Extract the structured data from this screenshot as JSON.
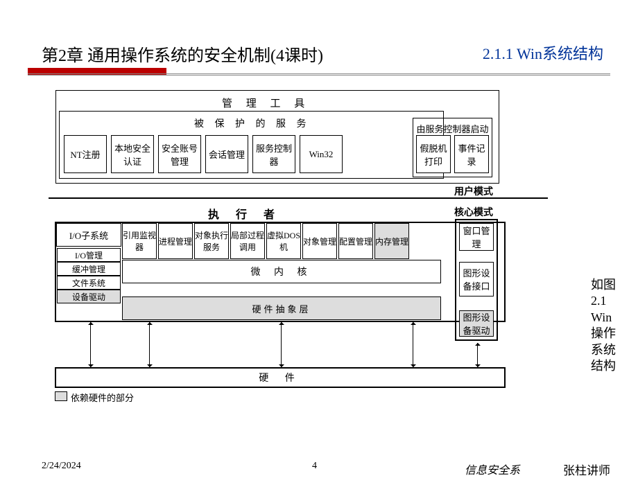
{
  "header": {
    "title": "第2章 通用操作系统的安全机制(4课时)",
    "subtitle": "2.1.1 Win系统结构"
  },
  "diagram": {
    "management_tools": "管 理 工 具",
    "protected_services": "被 保 护 的 服 务",
    "service_controller_start": "由服务控制器启动",
    "nt_registry": "NT注册",
    "local_security_auth": "本地安全认证",
    "security_account_mgr": "安全账号管理",
    "session_mgr": "会话管理",
    "service_controller": "服务控制器",
    "win32": "Win32",
    "print_spooler": "假脱机打印",
    "event_log": "事件记录",
    "user_mode": "用户模式",
    "kernel_mode": "核心模式",
    "executor": "执 行 者",
    "io_subsystem": "I/O子系统",
    "io_management": "I/O管理",
    "buffer_management": "缓冲管理",
    "file_system": "文件系统",
    "device_driver": "设备驱动",
    "reference_monitor": "引用监视器",
    "process_management": "进程管理",
    "object_exec_service": "对象执行服务",
    "lpc": "局部过程调用",
    "virtual_dos": "虚拟DOS机",
    "object_management": "对象管理",
    "config_management": "配置管理",
    "memory_management": "内存管理",
    "window_management": "窗口管理",
    "gfx_device_interface": "图形设备接口",
    "gfx_device_driver": "图形设备驱动",
    "microkernel": "微 内 核",
    "hal": "硬件抽象层",
    "hardware": "硬 件",
    "legend": "依赖硬件的部分"
  },
  "caption": "如图2.1 Win操作系统结构",
  "footer": {
    "date": "2/24/2024",
    "page": "4",
    "department": "信息安全系",
    "lecturer": "张柱讲师"
  }
}
